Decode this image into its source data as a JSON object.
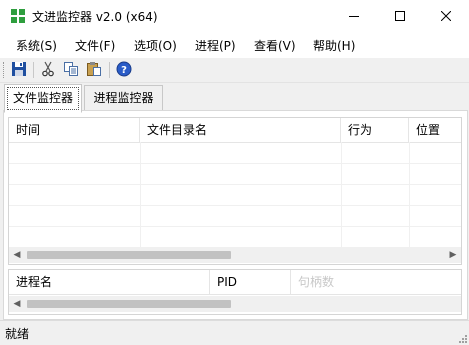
{
  "window": {
    "title": "文进监控器 v2.0 (x64)",
    "icon": "app-shield-icon",
    "controls": [
      "minimize-icon",
      "maximize-icon",
      "close-icon"
    ]
  },
  "menu": {
    "items": [
      {
        "label": "系统(S)"
      },
      {
        "label": "文件(F)"
      },
      {
        "label": "选项(O)"
      },
      {
        "label": "进程(P)"
      },
      {
        "label": "查看(V)"
      },
      {
        "label": "帮助(H)"
      }
    ]
  },
  "toolbar": {
    "buttons": [
      "save-icon",
      "cut-icon",
      "copy-icon",
      "paste-icon",
      "help-icon"
    ]
  },
  "tabs": [
    {
      "label": "文件监控器",
      "active": true
    },
    {
      "label": "进程监控器",
      "active": false
    }
  ],
  "file_list": {
    "columns": [
      "时间",
      "文件目录名",
      "行为",
      "位置"
    ],
    "rows": []
  },
  "process_list": {
    "columns": [
      "进程名",
      "PID",
      "句柄数"
    ],
    "rows": []
  },
  "status": {
    "text": "就绪"
  },
  "colors": {
    "icon_green": "#2e9e3e",
    "save_blue": "#1f4fa0",
    "help_blue": "#2a5cc8"
  }
}
